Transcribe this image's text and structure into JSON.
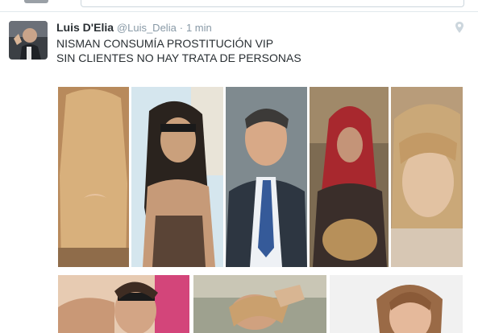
{
  "tweet": {
    "author_name": "Luis D'Elia",
    "author_handle": "@Luis_Delia",
    "separator": "·",
    "time": "1 min",
    "text_line_1": "NISMAN CONSUMÍA PROSTITUCIÓN VIP",
    "text_line_2": "SIN CLIENTES NO HAY TRATA DE PERSONAS"
  },
  "icons": {
    "location": "map-pin-icon"
  },
  "colors": {
    "name": "#292f33",
    "meta": "#8899a6",
    "border": "#e1e8ed"
  }
}
